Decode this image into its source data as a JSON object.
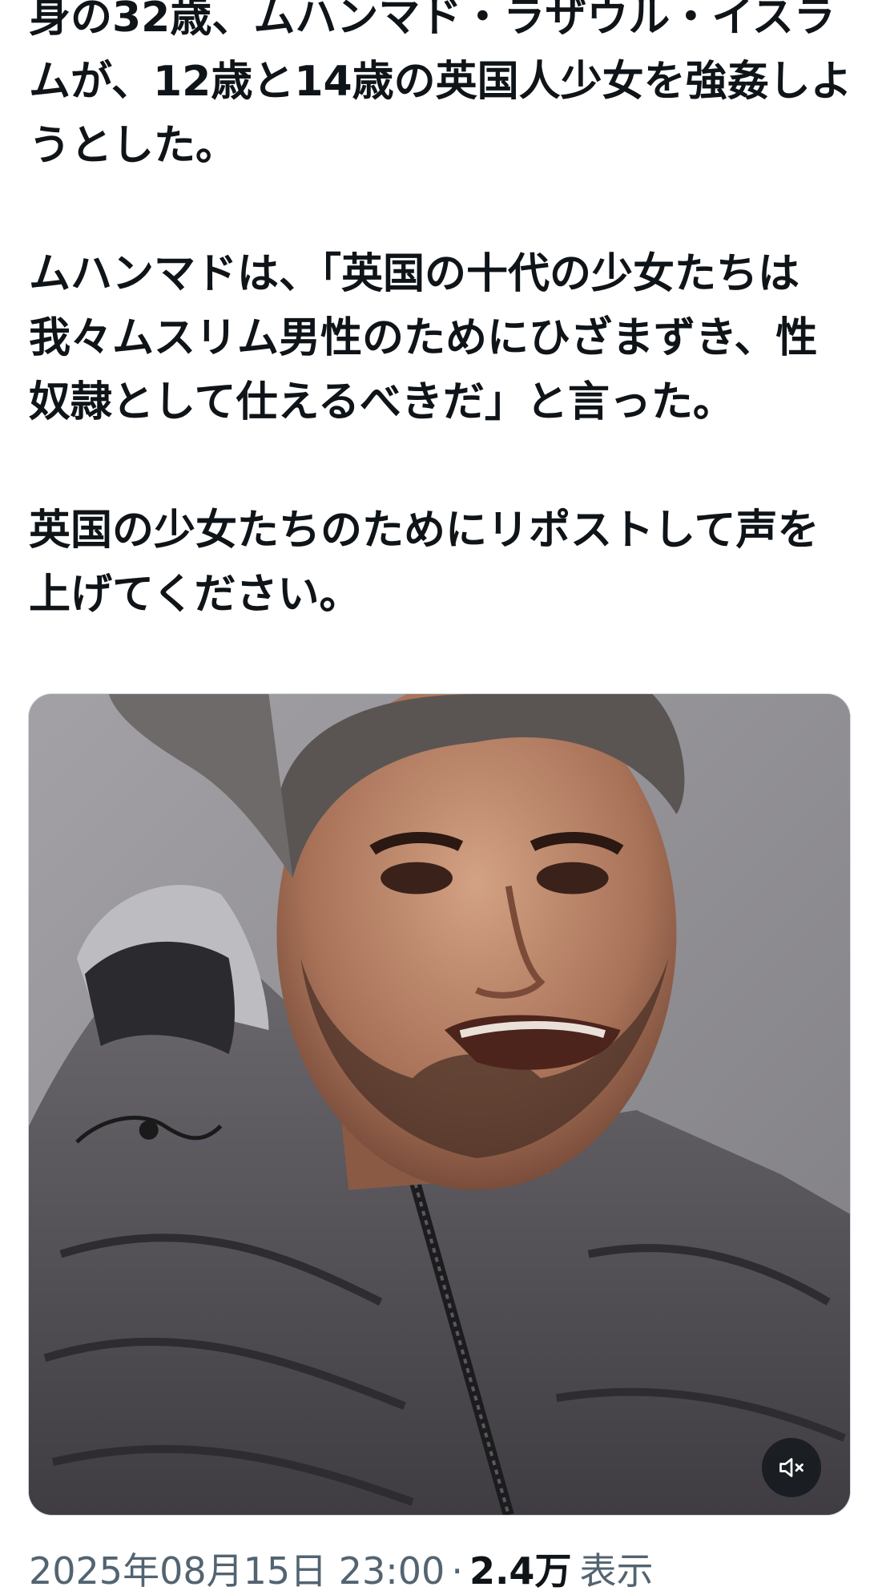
{
  "post": {
    "paragraphs": [
      "身の32歳、ムハンマド・ラザウル・イスラムが、12歳と14歳の英国人少女を強姦しようとした。",
      "ムハンマドは、「英国の十代の少女たちは我々ムスリム男性のためにひざまずき、性奴隷として仕えるべきだ」と言った。",
      "英国の少女たちのためにリポストして声を上げてください。"
    ]
  },
  "media": {
    "type": "video",
    "mute_icon": "speaker-muted-icon"
  },
  "meta": {
    "timestamp": "2025年08月15日 23:00",
    "separator": "·",
    "views_count": "2.4万",
    "views_label": "表示"
  }
}
